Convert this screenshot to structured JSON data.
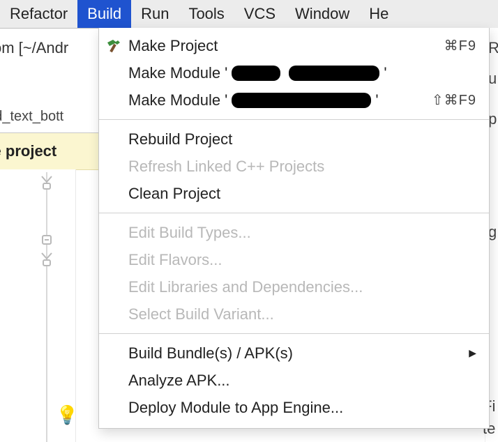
{
  "menubar": {
    "selected_index": 1,
    "items": [
      {
        "label": "Refactor"
      },
      {
        "label": "Build"
      },
      {
        "label": "Run"
      },
      {
        "label": "Tools"
      },
      {
        "label": "VCS"
      },
      {
        "label": "Window"
      },
      {
        "label": "He"
      }
    ]
  },
  "background": {
    "project_text": "om [~/Andr",
    "tab_text": "und_text_bott",
    "banner_text": "dle project",
    "right_chars": {
      "c0": "R",
      "c1": "u",
      "c2": ".p",
      "c3": "g",
      "c4": "Fi",
      "c5": "te"
    }
  },
  "dropdown": {
    "make_project": {
      "label": "Make Project",
      "shortcut": "⌘F9"
    },
    "make_module_1": {
      "prefix": "Make Module '",
      "suffix": "'"
    },
    "make_module_2": {
      "prefix": "Make Module '",
      "suffix": "'",
      "shortcut": "⇧⌘F9"
    },
    "rebuild_project": {
      "label": "Rebuild Project"
    },
    "refresh_cpp": {
      "label": "Refresh Linked C++ Projects"
    },
    "clean_project": {
      "label": "Clean Project"
    },
    "edit_build_types": {
      "label": "Edit Build Types..."
    },
    "edit_flavors": {
      "label": "Edit Flavors..."
    },
    "edit_libs": {
      "label": "Edit Libraries and Dependencies..."
    },
    "select_variant": {
      "label": "Select Build Variant..."
    },
    "build_bundle": {
      "label": "Build Bundle(s) / APK(s)"
    },
    "analyze_apk": {
      "label": "Analyze APK..."
    },
    "deploy_appengine": {
      "label": "Deploy Module to App Engine..."
    }
  }
}
